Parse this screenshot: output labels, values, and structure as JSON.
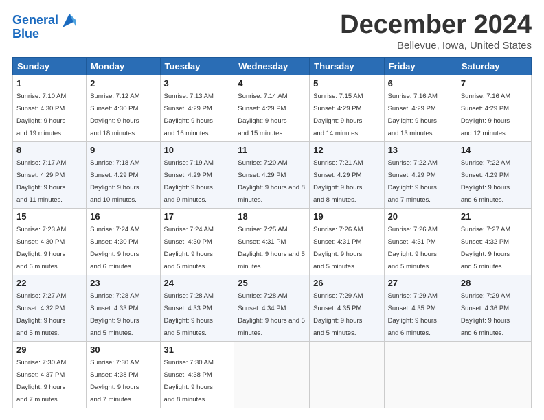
{
  "logo": {
    "text1": "General",
    "text2": "Blue"
  },
  "title": "December 2024",
  "subtitle": "Bellevue, Iowa, United States",
  "weekdays": [
    "Sunday",
    "Monday",
    "Tuesday",
    "Wednesday",
    "Thursday",
    "Friday",
    "Saturday"
  ],
  "weeks": [
    [
      {
        "day": "1",
        "sunrise": "7:10 AM",
        "sunset": "4:30 PM",
        "daylight": "9 hours and 19 minutes."
      },
      {
        "day": "2",
        "sunrise": "7:12 AM",
        "sunset": "4:30 PM",
        "daylight": "9 hours and 18 minutes."
      },
      {
        "day": "3",
        "sunrise": "7:13 AM",
        "sunset": "4:29 PM",
        "daylight": "9 hours and 16 minutes."
      },
      {
        "day": "4",
        "sunrise": "7:14 AM",
        "sunset": "4:29 PM",
        "daylight": "9 hours and 15 minutes."
      },
      {
        "day": "5",
        "sunrise": "7:15 AM",
        "sunset": "4:29 PM",
        "daylight": "9 hours and 14 minutes."
      },
      {
        "day": "6",
        "sunrise": "7:16 AM",
        "sunset": "4:29 PM",
        "daylight": "9 hours and 13 minutes."
      },
      {
        "day": "7",
        "sunrise": "7:16 AM",
        "sunset": "4:29 PM",
        "daylight": "9 hours and 12 minutes."
      }
    ],
    [
      {
        "day": "8",
        "sunrise": "7:17 AM",
        "sunset": "4:29 PM",
        "daylight": "9 hours and 11 minutes."
      },
      {
        "day": "9",
        "sunrise": "7:18 AM",
        "sunset": "4:29 PM",
        "daylight": "9 hours and 10 minutes."
      },
      {
        "day": "10",
        "sunrise": "7:19 AM",
        "sunset": "4:29 PM",
        "daylight": "9 hours and 9 minutes."
      },
      {
        "day": "11",
        "sunrise": "7:20 AM",
        "sunset": "4:29 PM",
        "daylight": "9 hours and 8 minutes."
      },
      {
        "day": "12",
        "sunrise": "7:21 AM",
        "sunset": "4:29 PM",
        "daylight": "9 hours and 8 minutes."
      },
      {
        "day": "13",
        "sunrise": "7:22 AM",
        "sunset": "4:29 PM",
        "daylight": "9 hours and 7 minutes."
      },
      {
        "day": "14",
        "sunrise": "7:22 AM",
        "sunset": "4:29 PM",
        "daylight": "9 hours and 6 minutes."
      }
    ],
    [
      {
        "day": "15",
        "sunrise": "7:23 AM",
        "sunset": "4:30 PM",
        "daylight": "9 hours and 6 minutes."
      },
      {
        "day": "16",
        "sunrise": "7:24 AM",
        "sunset": "4:30 PM",
        "daylight": "9 hours and 6 minutes."
      },
      {
        "day": "17",
        "sunrise": "7:24 AM",
        "sunset": "4:30 PM",
        "daylight": "9 hours and 5 minutes."
      },
      {
        "day": "18",
        "sunrise": "7:25 AM",
        "sunset": "4:31 PM",
        "daylight": "9 hours and 5 minutes."
      },
      {
        "day": "19",
        "sunrise": "7:26 AM",
        "sunset": "4:31 PM",
        "daylight": "9 hours and 5 minutes."
      },
      {
        "day": "20",
        "sunrise": "7:26 AM",
        "sunset": "4:31 PM",
        "daylight": "9 hours and 5 minutes."
      },
      {
        "day": "21",
        "sunrise": "7:27 AM",
        "sunset": "4:32 PM",
        "daylight": "9 hours and 5 minutes."
      }
    ],
    [
      {
        "day": "22",
        "sunrise": "7:27 AM",
        "sunset": "4:32 PM",
        "daylight": "9 hours and 5 minutes."
      },
      {
        "day": "23",
        "sunrise": "7:28 AM",
        "sunset": "4:33 PM",
        "daylight": "9 hours and 5 minutes."
      },
      {
        "day": "24",
        "sunrise": "7:28 AM",
        "sunset": "4:33 PM",
        "daylight": "9 hours and 5 minutes."
      },
      {
        "day": "25",
        "sunrise": "7:28 AM",
        "sunset": "4:34 PM",
        "daylight": "9 hours and 5 minutes."
      },
      {
        "day": "26",
        "sunrise": "7:29 AM",
        "sunset": "4:35 PM",
        "daylight": "9 hours and 5 minutes."
      },
      {
        "day": "27",
        "sunrise": "7:29 AM",
        "sunset": "4:35 PM",
        "daylight": "9 hours and 6 minutes."
      },
      {
        "day": "28",
        "sunrise": "7:29 AM",
        "sunset": "4:36 PM",
        "daylight": "9 hours and 6 minutes."
      }
    ],
    [
      {
        "day": "29",
        "sunrise": "7:30 AM",
        "sunset": "4:37 PM",
        "daylight": "9 hours and 7 minutes."
      },
      {
        "day": "30",
        "sunrise": "7:30 AM",
        "sunset": "4:38 PM",
        "daylight": "9 hours and 7 minutes."
      },
      {
        "day": "31",
        "sunrise": "7:30 AM",
        "sunset": "4:38 PM",
        "daylight": "9 hours and 8 minutes."
      },
      null,
      null,
      null,
      null
    ]
  ],
  "labels": {
    "sunrise": "Sunrise: ",
    "sunset": "Sunset: ",
    "daylight": "Daylight: "
  }
}
